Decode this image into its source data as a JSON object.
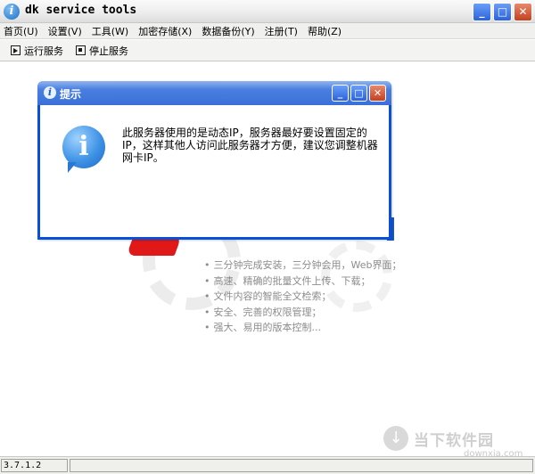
{
  "window": {
    "title": "dk service tools",
    "controls": {
      "minimize": "_",
      "maximize": "□",
      "close": "✕"
    }
  },
  "menu": [
    "首页(U)",
    "设置(V)",
    "工具(W)",
    "加密存储(X)",
    "数据备份(Y)",
    "注册(T)",
    "帮助(Z)"
  ],
  "toolbar": {
    "start_label": "运行服务",
    "stop_label": "停止服务"
  },
  "features": [
    "三分钟完成安装，三分钟会用，Web界面；",
    "高速、精确的批量文件上传、下载；",
    "文件内容的智能全文检索；",
    "安全、完善的权限管理；",
    "强大、易用的版本控制..."
  ],
  "statusbar": {
    "version": "3.7.1.2"
  },
  "watermark": {
    "text": "当下软件园",
    "sub": "downxia.com"
  },
  "dialog": {
    "title": "提示",
    "message": "此服务器使用的是动态IP，服务器最好要设置固定的IP，这样其他人访问此服务器才方便，建议您调整机器网卡IP。",
    "icon": "info-icon"
  },
  "colors": {
    "xp_title_blue": "#3a6fd8",
    "dialog_frame": "#0a4fd8",
    "close_red": "#c44020",
    "feature_text": "#8c8c8c"
  }
}
